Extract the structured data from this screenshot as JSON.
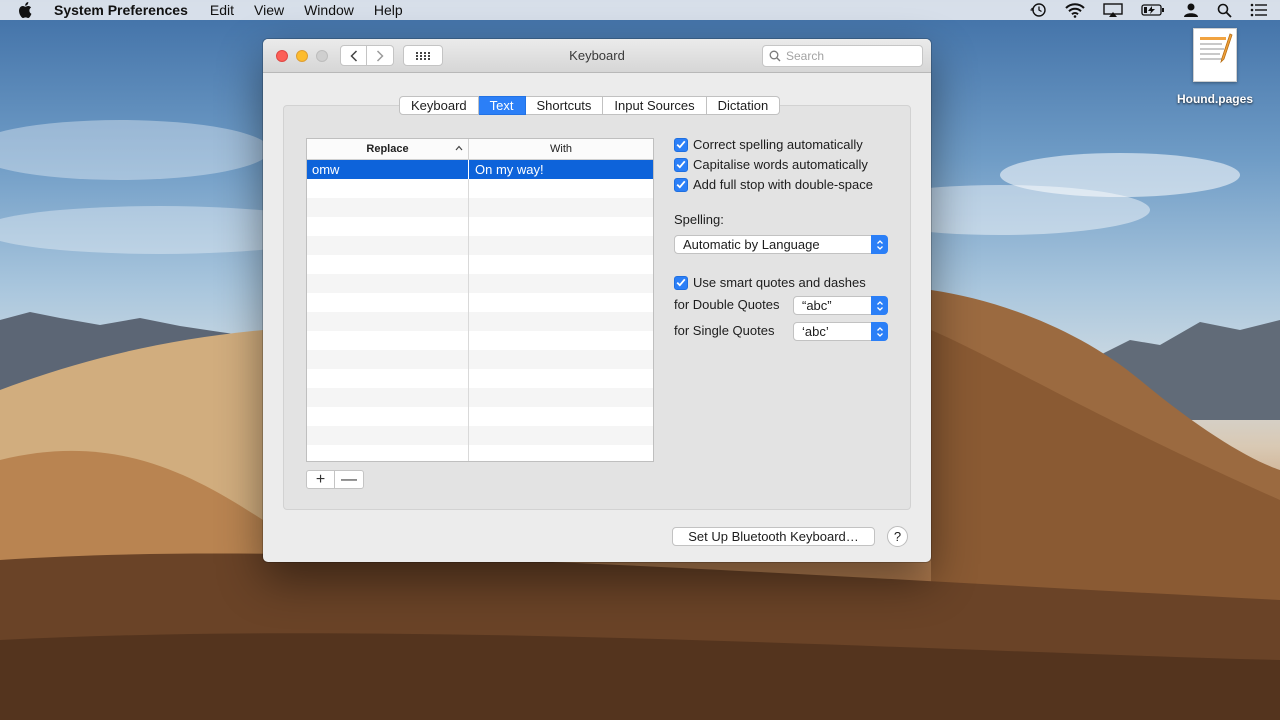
{
  "menubar": {
    "apple_icon": "apple-logo-icon",
    "app_name": "System Preferences",
    "items": [
      "Edit",
      "View",
      "Window",
      "Help"
    ],
    "status_icons": [
      "time-machine-icon",
      "wifi-icon",
      "airplay-icon",
      "battery-icon",
      "user-icon",
      "spotlight-icon",
      "notification-center-icon"
    ]
  },
  "desktop": {
    "file_label": "Hound.pages"
  },
  "window": {
    "title": "Keyboard",
    "search": {
      "placeholder": "Search",
      "value": ""
    },
    "tabs": [
      {
        "label": "Keyboard",
        "active": false
      },
      {
        "label": "Text",
        "active": true
      },
      {
        "label": "Shortcuts",
        "active": false
      },
      {
        "label": "Input Sources",
        "active": false
      },
      {
        "label": "Dictation",
        "active": false
      }
    ],
    "table": {
      "columns": [
        "Replace",
        "With"
      ],
      "rows": [
        {
          "replace": "omw",
          "with": "On my way!",
          "selected": true
        }
      ]
    },
    "options": {
      "correct_spelling": {
        "label": "Correct spelling automatically",
        "checked": true
      },
      "capitalise_words": {
        "label": "Capitalise words automatically",
        "checked": true
      },
      "full_stop": {
        "label": "Add full stop with double-space",
        "checked": true
      },
      "spelling_label": "Spelling:",
      "spelling_value": "Automatic by Language",
      "smart_quotes": {
        "label": "Use smart quotes and dashes",
        "checked": true
      },
      "double_quotes_label": "for Double Quotes",
      "double_quotes_value": "“abc”",
      "single_quotes_label": "for Single Quotes",
      "single_quotes_value": "‘abc’"
    },
    "bluetooth_button": "Set Up Bluetooth Keyboard…",
    "help_button": "?",
    "add_button": "+",
    "remove_button": "—"
  },
  "colors": {
    "accent": "#2b7ff7",
    "selection": "#0d63da"
  }
}
